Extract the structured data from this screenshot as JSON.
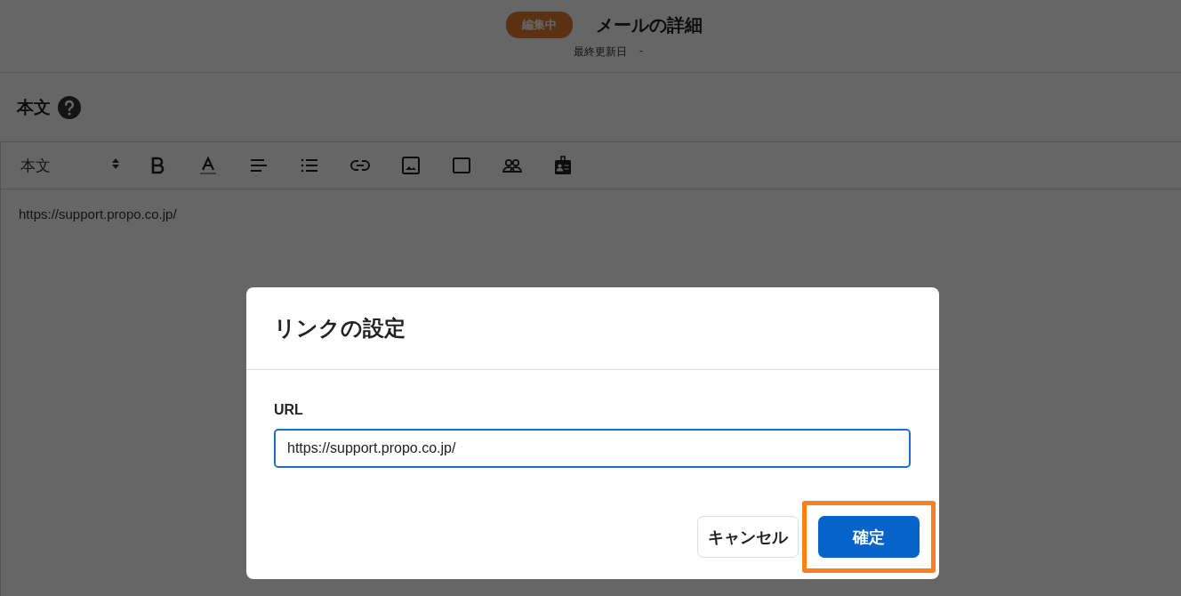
{
  "header": {
    "status_badge": "編集中",
    "title": "メールの詳細",
    "updated_label": "最終更新日",
    "updated_value": "-"
  },
  "body_section": {
    "label": "本文",
    "toolbar": {
      "style_select": "本文"
    },
    "content": "https://support.propo.co.jp/"
  },
  "dialog": {
    "title": "リンクの設定",
    "field": {
      "label": "URL",
      "value": "https://support.propo.co.jp/",
      "focused": true
    },
    "buttons": [
      {
        "label": "キャンセル",
        "kind": "secondary",
        "highlighted": false
      },
      {
        "label": "確定",
        "kind": "primary",
        "highlighted": true
      }
    ]
  }
}
